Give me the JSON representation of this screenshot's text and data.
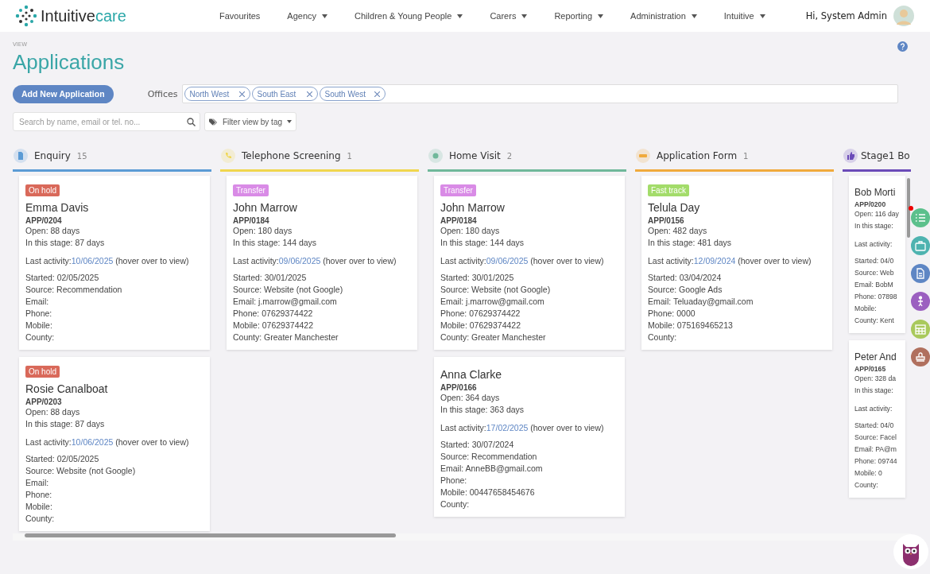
{
  "logo": {
    "text_dark": "Intuitive",
    "text_teal": "care"
  },
  "nav": [
    {
      "label": "Favourites",
      "has_menu": false
    },
    {
      "label": "Agency",
      "has_menu": true
    },
    {
      "label": "Children & Young People",
      "has_menu": true
    },
    {
      "label": "Carers",
      "has_menu": true
    },
    {
      "label": "Reporting",
      "has_menu": true
    },
    {
      "label": "Administration",
      "has_menu": true
    },
    {
      "label": "Intuitive",
      "has_menu": true
    }
  ],
  "user": {
    "greeting": "Hi, System Admin"
  },
  "page": {
    "eyebrow": "VIEW",
    "title": "Applications"
  },
  "toolbar": {
    "add_button": "Add New Application",
    "offices_label": "Offices",
    "offices": [
      "North West",
      "South East",
      "South West"
    ],
    "search_placeholder": "Search by name, email or tel. no...",
    "tag_filter": "Filter view by tag"
  },
  "columns": [
    {
      "title": "Enquiry",
      "count": "15",
      "color": "#5b9bd5",
      "cards": [
        {
          "tag": {
            "text": "On hold",
            "color": "#d9695a"
          },
          "name": "Emma Davis",
          "ref": "APP/0204",
          "open": "Open: 88 days",
          "stage": "In this stage: 87 days",
          "activity": {
            "label": "Last activity:",
            "date": "10/06/2025",
            "hint": "(hover over to view)"
          },
          "details": [
            "Started: 02/05/2025",
            "Source: Recommendation",
            "Email:",
            "Phone:",
            "Mobile:",
            "County:"
          ]
        },
        {
          "tag": {
            "text": "On hold",
            "color": "#d9695a"
          },
          "name": "Rosie Canalboat",
          "ref": "APP/0203",
          "open": "Open: 88 days",
          "stage": "In this stage: 87 days",
          "activity": {
            "label": "Last activity:",
            "date": "10/06/2025",
            "hint": "(hover over to view)"
          },
          "details": [
            "Started: 02/05/2025",
            "Source: Website (not Google)",
            "Email:",
            "Phone:",
            "Mobile:",
            "County:"
          ]
        }
      ]
    },
    {
      "title": "Telephone Screening",
      "count": "1",
      "color": "#f0d64e",
      "cards": [
        {
          "tag": {
            "text": "Transfer",
            "color": "#d98be6"
          },
          "name": "John Marrow",
          "ref": "APP/0184",
          "open": "Open: 180 days",
          "stage": "In this stage: 144 days",
          "activity": {
            "label": "Last activity:",
            "date": "09/06/2025",
            "hint": "(hover over to view)"
          },
          "details": [
            "Started: 30/01/2025",
            "Source: Website (not Google)",
            "Email: j.marrow@gmail.com",
            "Phone: 07629374422",
            "Mobile: 07629374422",
            "County: Greater Manchester"
          ]
        }
      ]
    },
    {
      "title": "Home Visit",
      "count": "2",
      "color": "#6fb89a",
      "cards": [
        {
          "tag": {
            "text": "Transfer",
            "color": "#d98be6"
          },
          "name": "John Marrow",
          "ref": "APP/0184",
          "open": "Open: 180 days",
          "stage": "In this stage: 144 days",
          "activity": {
            "label": "Last activity:",
            "date": "09/06/2025",
            "hint": "(hover over to view)"
          },
          "details": [
            "Started: 30/01/2025",
            "Source: Website (not Google)",
            "Email: j.marrow@gmail.com",
            "Phone: 07629374422",
            "Mobile: 07629374422",
            "County: Greater Manchester"
          ]
        },
        {
          "name": "Anna Clarke",
          "ref": "APP/0166",
          "open": "Open: 364 days",
          "stage": "In this stage: 363 days",
          "activity": {
            "label": "Last activity:",
            "date": "17/02/2025",
            "hint": "(hover over to view)"
          },
          "details": [
            "Started: 30/07/2024",
            "Source: Recommendation",
            "Email: AnneBB@gmail.com",
            "Phone:",
            "Mobile: 00447658454676",
            "County:"
          ]
        }
      ]
    },
    {
      "title": "Application Form",
      "count": "1",
      "color": "#f0aa3c",
      "cards": [
        {
          "tag": {
            "text": "Fast track",
            "color": "#a3dc6a"
          },
          "name": "Telula Day",
          "ref": "APP/0156",
          "open": "Open: 482 days",
          "stage": "In this stage: 481 days",
          "activity": {
            "label": "Last activity:",
            "date": "12/09/2024",
            "hint": "(hover over to view)"
          },
          "details": [
            "Started: 03/04/2024",
            "Source: Google Ads",
            "Email: Teluaday@gmail.com",
            "Phone: 0000",
            "Mobile: 075169465213",
            "County:"
          ]
        }
      ]
    },
    {
      "title": "Stage1 Bo",
      "color": "#6b4bb8",
      "cards": [
        {
          "name": "Bob Morti",
          "ref": "APP/0200",
          "open": "Open: 116 day",
          "stage": "In this stage:",
          "activity": {
            "label": "Last activity:"
          },
          "details": [
            "Started: 04/0",
            "Source: Web",
            "Email: BobM",
            "Phone: 07898",
            "Mobile:",
            "County: Kent"
          ]
        },
        {
          "name": "Peter And",
          "ref": "APP/0165",
          "open": "Open: 328 da",
          "stage": "In this stage:",
          "activity": {
            "label": "Last activity:"
          },
          "details": [
            "Started: 04/0",
            "Source: Facel",
            "Email: PA@m",
            "Phone: 09744",
            "Mobile: 0",
            "County:"
          ]
        }
      ]
    }
  ],
  "side_actions": [
    {
      "color": "#5cc08c",
      "alert": true
    },
    {
      "color": "#4eb3b0",
      "alert": false
    },
    {
      "color": "#5e86c4",
      "alert": false
    },
    {
      "color": "#9b5fc0",
      "alert": false
    },
    {
      "color": "#a9c95c",
      "alert": false
    },
    {
      "color": "#b0705e",
      "alert": false
    }
  ]
}
